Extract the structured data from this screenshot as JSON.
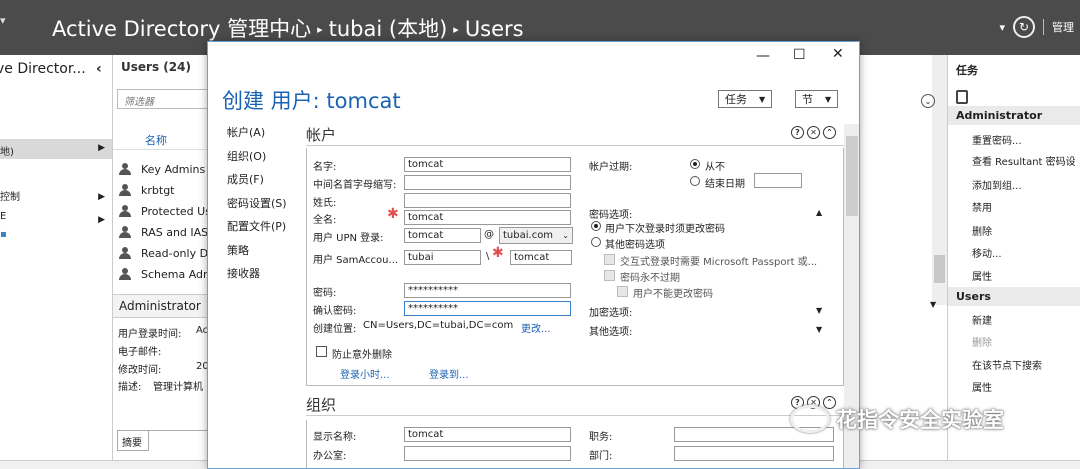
{
  "app": {
    "breadcrumb": [
      "Active Directory 管理中心",
      "tubai (本地)",
      "Users"
    ],
    "manage_label": "管理"
  },
  "leftpane": {
    "title": "ve Director...",
    "selected_item": "地)",
    "item_2": "控制",
    "item_3": "E"
  },
  "listpane": {
    "header": "Users  (24)",
    "filter_placeholder": "筛选器",
    "column_name": "名称",
    "items": [
      "Key Admins",
      "krbtgt",
      "Protected Us",
      "RAS and IAS",
      "Read-only D",
      "Schema Adn"
    ],
    "detail_title": "Administrator",
    "details": [
      {
        "label": "用户登录时间:",
        "value": "Ac"
      },
      {
        "label": "电子邮件:",
        "value": ""
      },
      {
        "label": "修改时间:",
        "value": "20"
      },
      {
        "label": "描述:",
        "value": "管理计算机"
      }
    ],
    "tab_summary": "摘要"
  },
  "taskpane": {
    "title": "任务",
    "section1": "Administrator",
    "actions1": [
      "重置密码...",
      "查看 Resultant 密码设",
      "添加到组...",
      "禁用",
      "删除",
      "移动...",
      "属性"
    ],
    "section2": "Users",
    "actions2": [
      "新建",
      "删除",
      "在该节点下搜索",
      "属性"
    ]
  },
  "dialog": {
    "title": "创建 用户: tomcat",
    "tasks_label": "任务",
    "sections_label": "节",
    "nav": [
      "帐户(A)",
      "组织(O)",
      "成员(F)",
      "密码设置(S)",
      "配置文件(P)",
      "策略",
      "接收器"
    ],
    "account_header": "帐户",
    "fields": {
      "first_name_label": "名字:",
      "first_name": "tomcat",
      "initials_label": "中间名首字母缩写:",
      "last_name_label": "姓氏:",
      "full_name_label": "全名:",
      "full_name": "tomcat",
      "upn_label": "用户 UPN 登录:",
      "upn_user": "tomcat",
      "upn_at": "@",
      "upn_domain": "tubai.com",
      "sam_label": "用户 SamAccou...",
      "sam_domain": "tubai",
      "sam_sep": "\\",
      "sam_user": "tomcat",
      "password_label": "密码:",
      "password": "**********",
      "confirm_label": "确认密码:",
      "confirm": "**********",
      "create_in_label": "创建位置:",
      "create_in": "CN=Users,DC=tubai,DC=com",
      "change_link": "更改...",
      "protect_label": "防止意外删除",
      "logon_hours_link": "登录小时...",
      "logon_to_link": "登录到..."
    },
    "expiry": {
      "label": "帐户过期:",
      "never": "从不",
      "end_date": "结束日期"
    },
    "password_options": {
      "label": "密码选项:",
      "opt_change_next": "用户下次登录时须更改密码",
      "opt_other": "其他密码选项",
      "passport": "交互式登录时需要 Microsoft Passport 或...",
      "never_expires": "密码永不过期",
      "cannot_change": "用户不能更改密码"
    },
    "encryption_label": "加密选项:",
    "other_label": "其他选项:",
    "org_header": "组织",
    "org": {
      "display_name_label": "显示名称:",
      "display_name": "tomcat",
      "office_label": "办公室:",
      "title_label": "职务:",
      "dept_label": "部门:"
    }
  },
  "watermark": "花指令安全实验室"
}
